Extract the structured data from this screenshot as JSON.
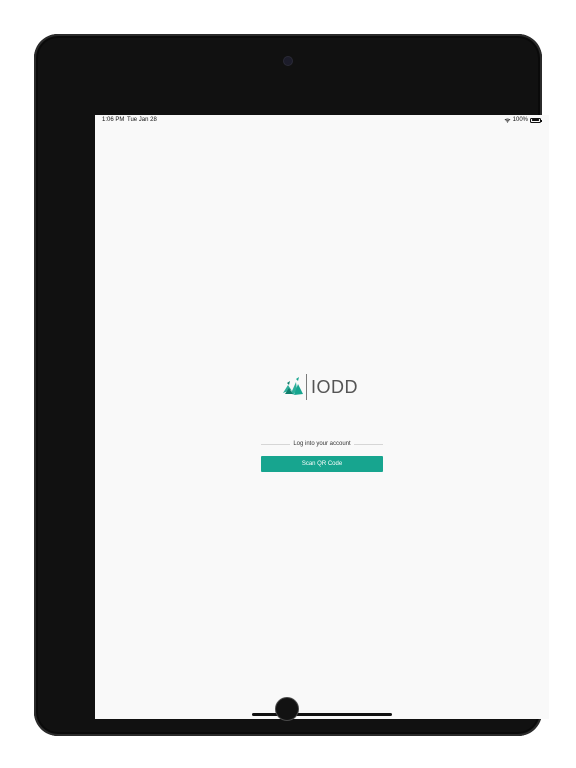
{
  "status_bar": {
    "time": "1:06 PM",
    "date": "Tue Jan 28",
    "battery": "100%"
  },
  "logo": {
    "text": "IODD"
  },
  "login": {
    "label": "Log into your account",
    "scan_button": "Scan QR Code"
  },
  "colors": {
    "accent": "#17a58f",
    "screen_bg": "#f9f9f9",
    "device_frame": "#111111"
  },
  "icons": {
    "wifi": "wifi-icon",
    "battery": "battery-icon",
    "logo_mark": "iodd-logo-icon"
  }
}
